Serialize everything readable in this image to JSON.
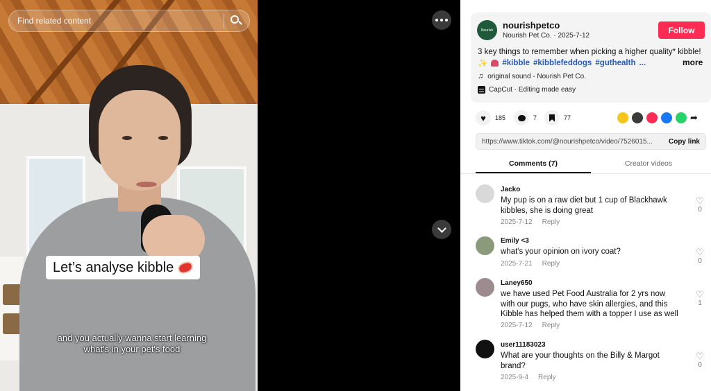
{
  "search": {
    "placeholder": "Find related content"
  },
  "video": {
    "overlay_title": "Let’s analyse kibble",
    "caption": "and you actually wanna start learning what's in your pet's food"
  },
  "author": {
    "avatar_text": "Nourish",
    "username": "nourishpetco",
    "display_name": "Nourish Pet Co.",
    "separator": "·",
    "date": "2025-7-12",
    "follow_label": "Follow"
  },
  "description": {
    "line1": "3 key things to remember when picking a higher quality* kibble!",
    "sparkle": "✨",
    "tags": [
      "#kibble",
      "#kibblefeddogs",
      "#guthealth"
    ],
    "ellipsis": "...",
    "more_label": "more"
  },
  "sound": {
    "label": "original sound - Nourish Pet Co."
  },
  "capcut": {
    "label": "CapCut · Editing made easy"
  },
  "actions": {
    "likes": "185",
    "comments": "7",
    "saves": "77"
  },
  "share": {
    "colors": [
      "#f5c518",
      "#3b3b3b",
      "#fe2c55",
      "#1877f2",
      "#25d366"
    ]
  },
  "link": {
    "url": "https://www.tiktok.com/@nourishpetco/video/7526015...",
    "copy_label": "Copy link"
  },
  "tabs": {
    "comments": "Comments (7)",
    "creator": "Creator videos"
  },
  "comments": [
    {
      "name": "Jacko",
      "text": "My pup is on a raw diet but 1 cup of Blackhawk kibbles, she is doing great",
      "date": "2025-7-12",
      "reply": "Reply",
      "likes": "0",
      "avatar": "#d9d9d9"
    },
    {
      "name": "Emily <3",
      "text": "what's your opinion on ivory coat?",
      "date": "2025-7-21",
      "reply": "Reply",
      "likes": "0",
      "avatar": "#8a9a7a"
    },
    {
      "name": "Laney650",
      "text": "we have used Pet Food Australia for 2 yrs now with our pugs, who have skin allergies, and this Kibble has helped them with a topper I use as well",
      "date": "2025-7-12",
      "reply": "Reply",
      "likes": "1",
      "avatar": "#9d8c8f"
    },
    {
      "name": "user11183023",
      "text": "What are your thoughts on the Billy & Margot brand?",
      "date": "2025-9-4",
      "reply": "Reply",
      "likes": "0",
      "avatar": "#111111"
    }
  ]
}
